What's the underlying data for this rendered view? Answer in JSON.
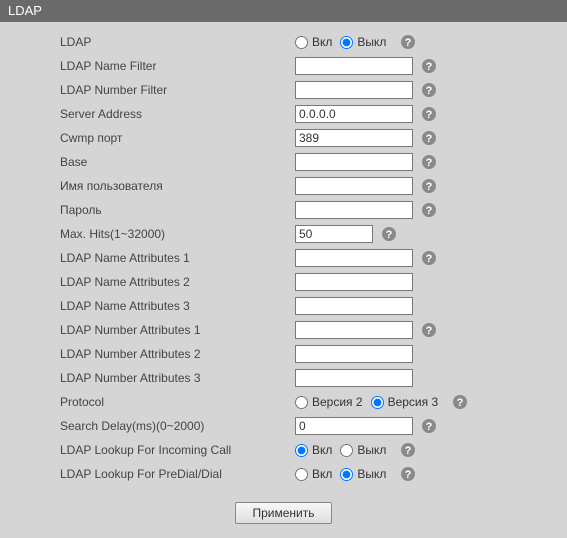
{
  "panel": {
    "title": "LDAP"
  },
  "common": {
    "on": "Вкл",
    "off": "Выкл",
    "v2": "Версия 2",
    "v3": "Версия 3",
    "apply": "Применить"
  },
  "fields": {
    "ldap": {
      "label": "LDAP",
      "value": "off"
    },
    "nameFilter": {
      "label": "LDAP Name Filter",
      "value": ""
    },
    "numberFilter": {
      "label": "LDAP Number Filter",
      "value": ""
    },
    "serverAddress": {
      "label": "Server Address",
      "value": "0.0.0.0"
    },
    "cwmpPort": {
      "label": "Cwmp порт",
      "value": "389"
    },
    "base": {
      "label": "Base",
      "value": ""
    },
    "username": {
      "label": "Имя пользователя",
      "value": ""
    },
    "password": {
      "label": "Пароль",
      "value": ""
    },
    "maxHits": {
      "label": "Max. Hits(1~32000)",
      "value": "50"
    },
    "nameAttr1": {
      "label": "LDAP Name Attributes 1",
      "value": ""
    },
    "nameAttr2": {
      "label": "LDAP Name Attributes 2",
      "value": ""
    },
    "nameAttr3": {
      "label": "LDAP Name Attributes 3",
      "value": ""
    },
    "numAttr1": {
      "label": "LDAP Number Attributes 1",
      "value": ""
    },
    "numAttr2": {
      "label": "LDAP Number Attributes 2",
      "value": ""
    },
    "numAttr3": {
      "label": "LDAP Number Attributes 3",
      "value": ""
    },
    "protocol": {
      "label": "Protocol",
      "value": "v3"
    },
    "searchDelay": {
      "label": "Search Delay(ms)(0~2000)",
      "value": "0"
    },
    "lookupIncoming": {
      "label": "LDAP Lookup For Incoming Call",
      "value": "on"
    },
    "lookupPredial": {
      "label": "LDAP Lookup For PreDial/Dial",
      "value": "off"
    }
  }
}
